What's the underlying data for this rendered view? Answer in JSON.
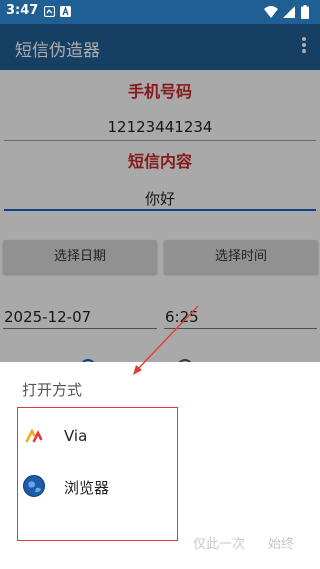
{
  "status_bar": {
    "time": "3:47"
  },
  "app_bar": {
    "title": "短信伪造器"
  },
  "form": {
    "phone_label": "手机号码",
    "phone_value": "12123441234",
    "content_label": "短信内容",
    "content_value": "你好",
    "select_date_label": "选择日期",
    "select_time_label": "选择时间",
    "date_value": "2025-12-07",
    "time_value": "6:25"
  },
  "chooser": {
    "title": "打开方式",
    "apps": [
      {
        "label": "Via",
        "icon": "via-icon"
      },
      {
        "label": "浏览器",
        "icon": "browser-globe-icon"
      }
    ],
    "just_once_label": "仅此一次",
    "always_label": "始终"
  },
  "colors": {
    "primary": "#1f5f94",
    "label_red": "#c62828",
    "annotation_red": "#e53935",
    "accent": "#1565c0"
  }
}
